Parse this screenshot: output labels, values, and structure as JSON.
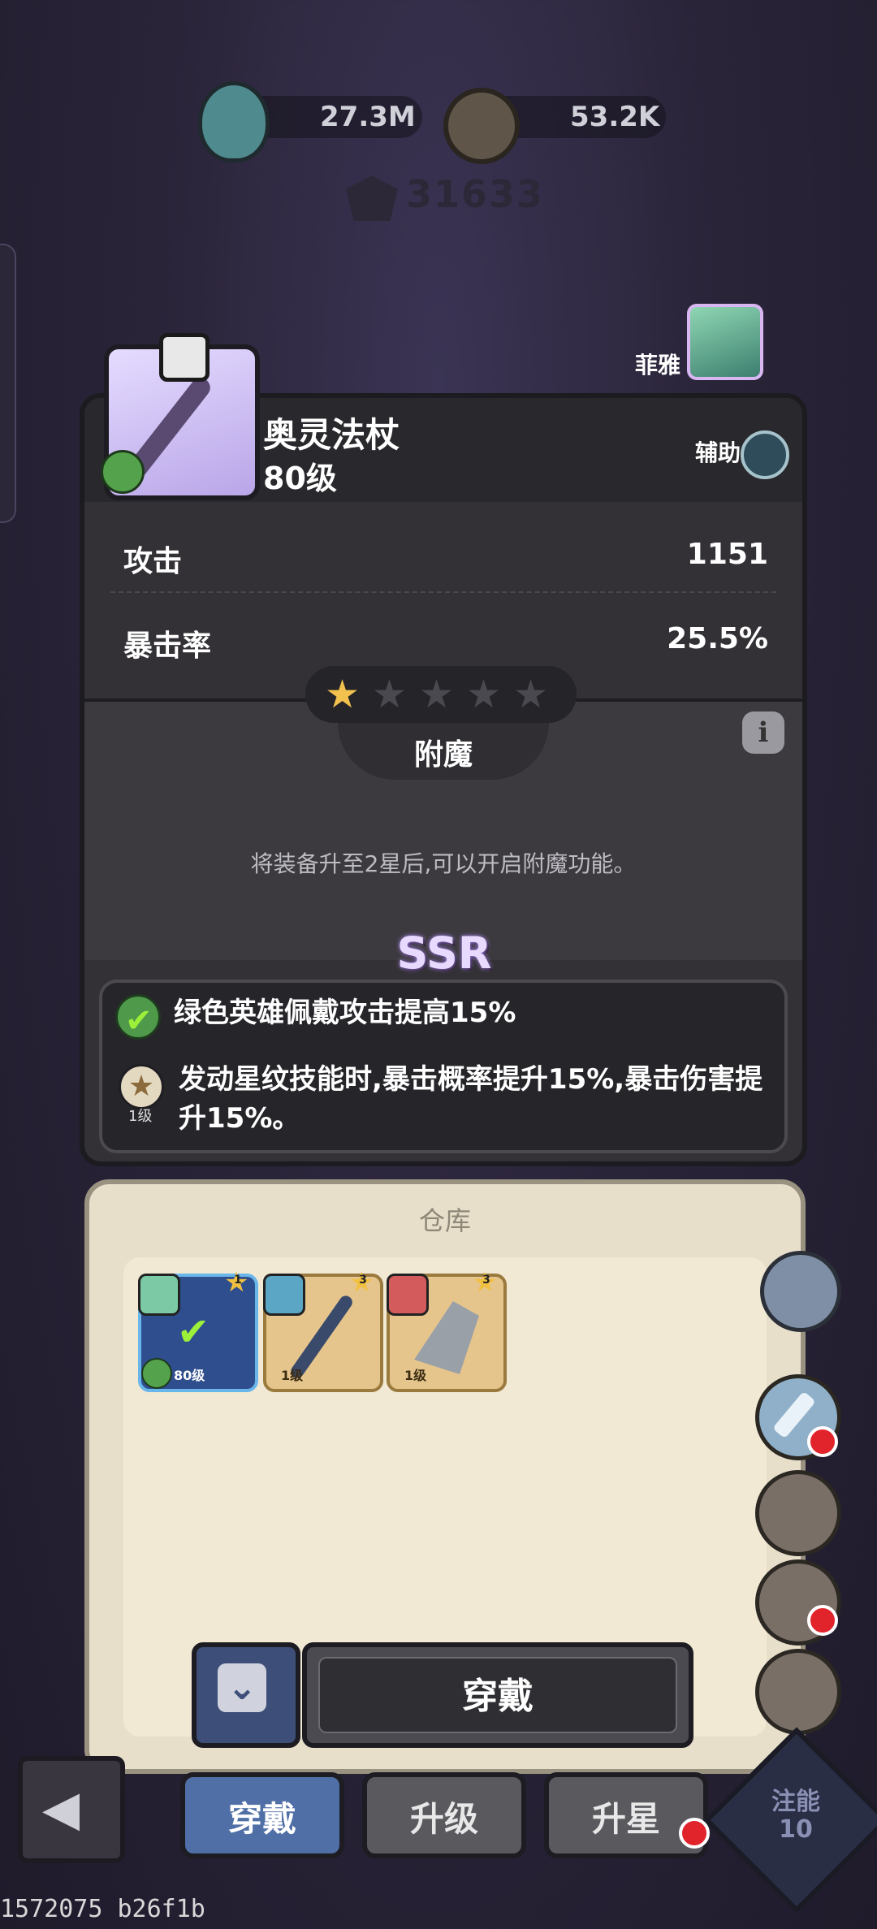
{
  "resources": {
    "potion": "27.3M",
    "coin": "53.2K"
  },
  "power": "31633",
  "hero": {
    "name": "菲雅"
  },
  "item": {
    "name": "奥灵法杖",
    "level": "80级",
    "role": "辅助",
    "stats": [
      {
        "label": "攻击",
        "value": "1151"
      },
      {
        "label": "暴击率",
        "value": "25.5%"
      }
    ],
    "stars": 1,
    "stars_max": 5
  },
  "enchant": {
    "title": "附魔",
    "tip": "将装备升至2星后,可以开启附魔功能。"
  },
  "rarity": "SSR",
  "skills": {
    "line1": "绿色英雄佩戴攻击提高15%",
    "line2a": "发动星纹技能时,暴击概率提升15%,暴击伤害提",
    "line2b": "升15%。",
    "star_level": "1级"
  },
  "warehouse": {
    "title": "仓库",
    "cards": [
      {
        "level": "80级",
        "star": "1"
      },
      {
        "level": "1级",
        "star": "3"
      },
      {
        "level": "1级",
        "star": "3"
      }
    ]
  },
  "buttons": {
    "equip": "穿戴"
  },
  "tabs": [
    {
      "label": "穿戴"
    },
    {
      "label": "升级"
    },
    {
      "label": "升星"
    }
  ],
  "corner": {
    "label_a": "注能",
    "label_b": "10"
  },
  "footer": "1572075 b26f1b",
  "colors": {
    "panel": "#333135",
    "warehouse": "#e8dfcb",
    "tab_active": "#4f6fa6",
    "tab_inactive": "#5a595e",
    "red_dot": "#e1242c",
    "rarity_glow": "#b48cff"
  }
}
